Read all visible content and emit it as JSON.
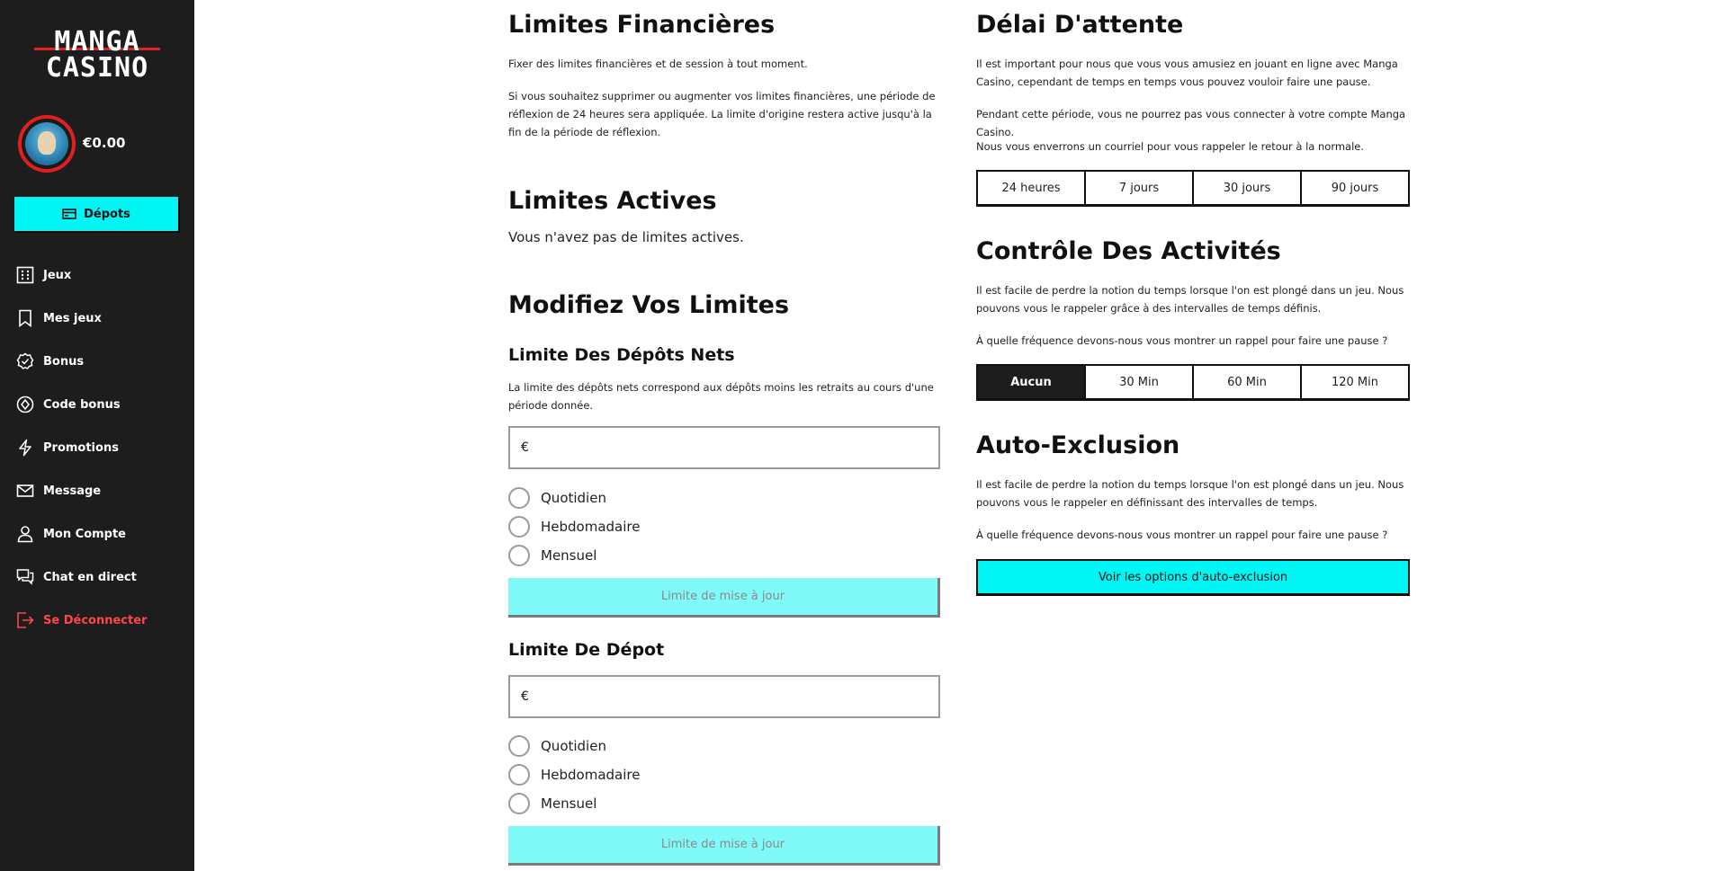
{
  "brand": {
    "logo_line1": "MANGA",
    "logo_line2": "CASINO",
    "accent": "#00f5f5",
    "danger": "#ff4747"
  },
  "user": {
    "balance": "€0.00"
  },
  "sidebar": {
    "deposit_label": "Dépots",
    "items": [
      {
        "label": "Jeux",
        "icon": "grid-icon"
      },
      {
        "label": "Mes jeux",
        "icon": "bookmark-icon"
      },
      {
        "label": "Bonus",
        "icon": "badge-check-icon"
      },
      {
        "label": "Code bonus",
        "icon": "coin-icon"
      },
      {
        "label": "Promotions",
        "icon": "lightning-icon"
      },
      {
        "label": "Message",
        "icon": "envelope-icon"
      },
      {
        "label": "Mon Compte",
        "icon": "user-icon"
      },
      {
        "label": "Chat en direct",
        "icon": "chat-icon"
      },
      {
        "label": "Se Déconnecter",
        "icon": "logout-icon"
      }
    ]
  },
  "financial": {
    "title": "Limites Financières",
    "p1": "Fixer des limites financières et de session à tout moment.",
    "p2": "Si vous souhaitez supprimer ou augmenter vos limites financières, une période de réflexion de 24 heures sera appliquée. La limite d'origine restera active jusqu'à la fin de la période de réflexion."
  },
  "active_limits": {
    "title": "Limites Actives",
    "text": "Vous n'avez pas de limites actives."
  },
  "modify": {
    "title": "Modifiez Vos Limites"
  },
  "net_deposit": {
    "title": "Limite Des Dépôts Nets",
    "desc": "La limite des dépôts nets correspond aux dépôts moins les retraits au cours d'une période donnée.",
    "currency": "€",
    "value": "",
    "options": [
      "Quotidien",
      "Hebdomadaire",
      "Mensuel"
    ],
    "button": "Limite de mise à jour"
  },
  "deposit_limit": {
    "title": "Limite De Dépot",
    "currency": "€",
    "value": "",
    "options": [
      "Quotidien",
      "Hebdomadaire",
      "Mensuel"
    ],
    "button": "Limite de mise à jour"
  },
  "cooling": {
    "title": "Délai D'attente",
    "p1": "Il est important pour nous que vous vous amusiez en jouant en ligne avec Manga Casino, cependant de temps en temps vous pouvez vouloir faire une pause.",
    "p2": "Pendant cette période, vous ne pourrez pas vous connecter à votre compte Manga Casino.",
    "p3": "Nous vous enverrons un courriel pour vous rappeler le retour à la normale.",
    "options": [
      "24 heures",
      "7 jours",
      "30 jours",
      "90 jours"
    ]
  },
  "activity": {
    "title": "Contrôle Des Activités",
    "p1": "Il est facile de perdre la notion du temps lorsque l'on est plongé dans un jeu. Nous pouvons vous le rappeler grâce à des intervalles de temps définis.",
    "p2": "À quelle fréquence devons-nous vous montrer un rappel pour faire une pause ?",
    "options": [
      "Aucun",
      "30 Min",
      "60 Min",
      "120 Min"
    ],
    "selected": "Aucun"
  },
  "exclusion": {
    "title": "Auto-Exclusion",
    "p1": "Il est facile de perdre la notion du temps lorsque l'on est plongé dans un jeu. Nous pouvons vous le rappeler en définissant des intervalles de temps.",
    "p2": "À quelle fréquence devons-nous vous montrer un rappel pour faire une pause ?",
    "button": "Voir les options d'auto-exclusion"
  }
}
